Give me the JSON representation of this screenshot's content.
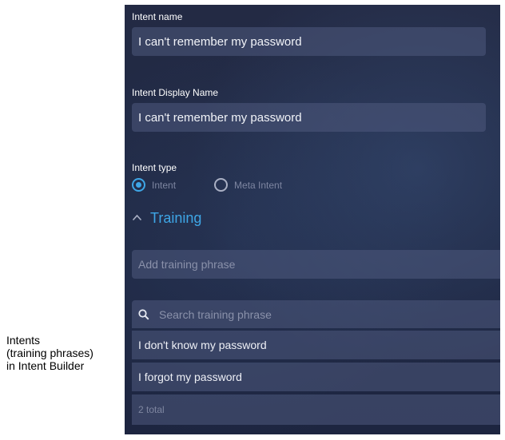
{
  "caption": {
    "line1": "Intents",
    "line2": "(training phrases)",
    "line3": "in Intent Builder"
  },
  "intent_name": {
    "label": "Intent name",
    "value": "I can't remember my password"
  },
  "intent_display_name": {
    "label": "Intent Display Name",
    "value": "I can't remember my password"
  },
  "intent_type": {
    "label": "Intent type",
    "options": [
      {
        "label": "Intent",
        "selected": true
      },
      {
        "label": "Meta Intent",
        "selected": false
      }
    ]
  },
  "training": {
    "title": "Training",
    "add_placeholder": "Add training phrase",
    "search_placeholder": "Search training phrase",
    "phrases": [
      "I don't know my password",
      "I forgot my password"
    ],
    "total": "2 total"
  },
  "colors": {
    "accent": "#3ea6e6",
    "panel_bg": "#202944"
  }
}
